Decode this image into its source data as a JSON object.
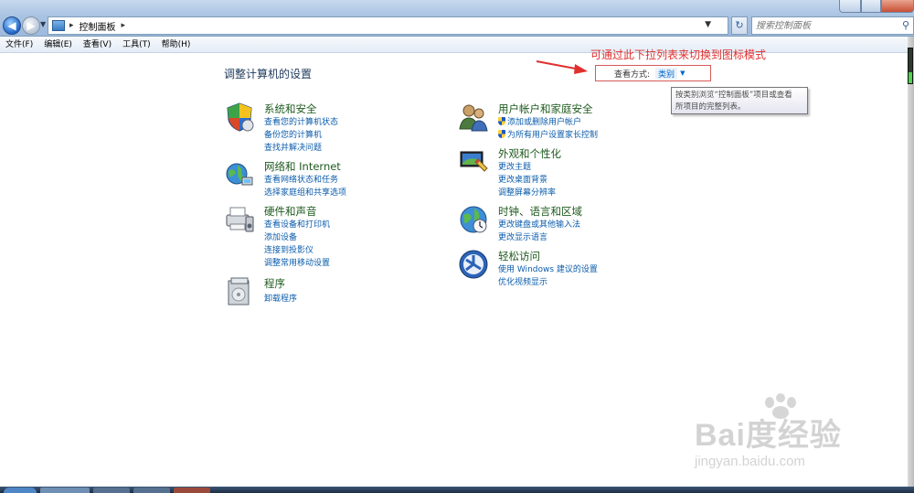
{
  "window": {
    "address_crumb": "控制面板",
    "search_placeholder": "搜索控制面板"
  },
  "menubar": {
    "items": [
      "文件(F)",
      "编辑(E)",
      "查看(V)",
      "工具(T)",
      "帮助(H)"
    ]
  },
  "main": {
    "title": "调整计算机的设置",
    "view_by_label": "查看方式:",
    "view_by_value": "类别",
    "tooltip": [
      "按类别浏览“控制面板”项目或查看",
      "所项目的完整列表。"
    ],
    "annotation": "可通过此下拉列表来切换到图标模式",
    "annotation_color": "#e0302e"
  },
  "categories_left": [
    {
      "title": "系统和安全",
      "icon": "shield-icon",
      "links": [
        "查看您的计算机状态",
        "备份您的计算机",
        "查找并解决问题"
      ]
    },
    {
      "title": "网络和 Internet",
      "icon": "network-globe-icon",
      "links": [
        "查看网络状态和任务",
        "选择家庭组和共享选项"
      ]
    },
    {
      "title": "硬件和声音",
      "icon": "printer-icon",
      "links": [
        "查看设备和打印机",
        "添加设备",
        "连接到投影仪",
        "调整常用移动设置"
      ]
    },
    {
      "title": "程序",
      "icon": "programs-box-icon",
      "links": [
        "卸载程序"
      ]
    }
  ],
  "categories_right": [
    {
      "title": "用户帐户和家庭安全",
      "icon": "users-icon",
      "links": [
        "添加或删除用户帐户",
        "为所有用户设置家长控制"
      ],
      "shield_links": true
    },
    {
      "title": "外观和个性化",
      "icon": "appearance-monitor-icon",
      "links": [
        "更改主题",
        "更改桌面背景",
        "调整屏幕分辨率"
      ]
    },
    {
      "title": "时钟、语言和区域",
      "icon": "clock-globe-icon",
      "links": [
        "更改键盘或其他输入法",
        "更改显示语言"
      ]
    },
    {
      "title": "轻松访问",
      "icon": "ease-of-access-icon",
      "links": [
        "使用 Windows 建议的设置",
        "优化视频显示"
      ]
    }
  ],
  "watermark": {
    "logo": "Bai度经验",
    "site": "jingyan.baidu.com"
  }
}
